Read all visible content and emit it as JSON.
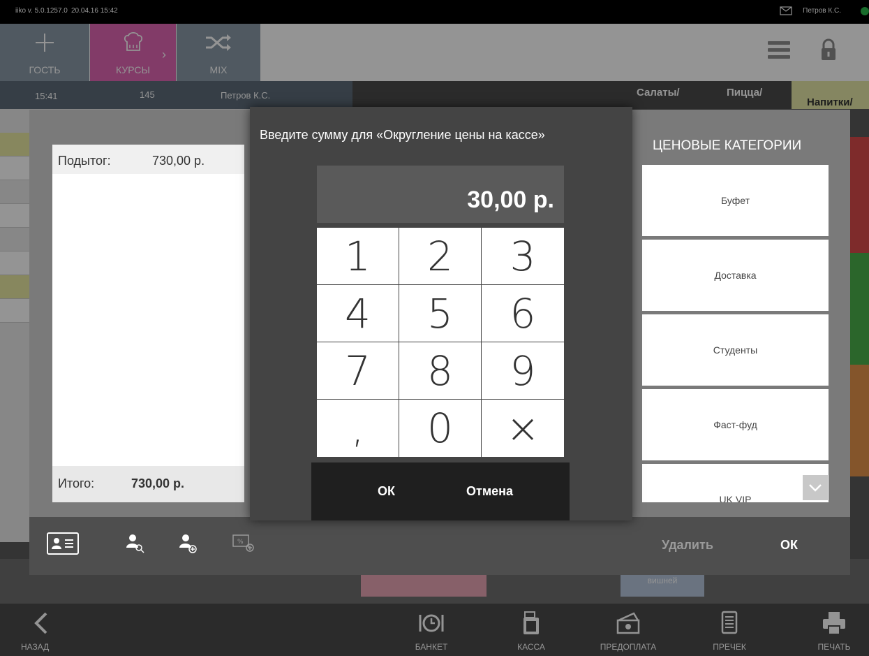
{
  "status_bar": {
    "version": "iiko v. 5.0.1257.0",
    "datetime": "20.04.16 15:42",
    "user": "Петров К.С."
  },
  "toolbar": {
    "guest_label": "ГОСТЬ",
    "courses_label": "КУРСЫ",
    "mix_label": "MIX"
  },
  "order_info": {
    "time": "15:41",
    "order_number": "145",
    "waiter": "Петров К.С."
  },
  "categories": [
    "Салаты/",
    "Пицца/",
    "Напитки/"
  ],
  "discount_dialog": {
    "subtotal_label": "Подытог:",
    "subtotal_value": "730,00 р.",
    "total_label": "Итого:",
    "total_value": "730,00 р.",
    "price_categories_title": "ЦЕНОВЫЕ КАТЕГОРИИ",
    "price_categories": [
      "Буфет",
      "Доставка",
      "Студенты",
      "Фаст-фуд",
      "UK VIP"
    ],
    "delete_label": "Удалить",
    "ok_label": "ОК"
  },
  "amount_modal": {
    "title": "Введите сумму для «Округление цены на кассе»",
    "value": "30,00 р.",
    "keys": [
      "1",
      "2",
      "3",
      "4",
      "5",
      "6",
      "7",
      "8",
      "9",
      ",",
      "0",
      "×"
    ],
    "ok_label": "ОК",
    "cancel_label": "Отмена"
  },
  "background_labels": {
    "cherry_label": "вишней"
  },
  "bottom_bar": {
    "back": "НАЗАД",
    "banquet": "БАНКЕТ",
    "cash": "КАССА",
    "prepay": "ПРЕДОПЛАТА",
    "precheck": "ПРЕЧЕК",
    "print": "ПЕЧАТЬ"
  },
  "colors": {
    "accent_pink": "#e066b3",
    "toolbar_grey_blue": "#8a9aa8",
    "modal_bg": "#444444",
    "status_green": "#2ab84a"
  }
}
